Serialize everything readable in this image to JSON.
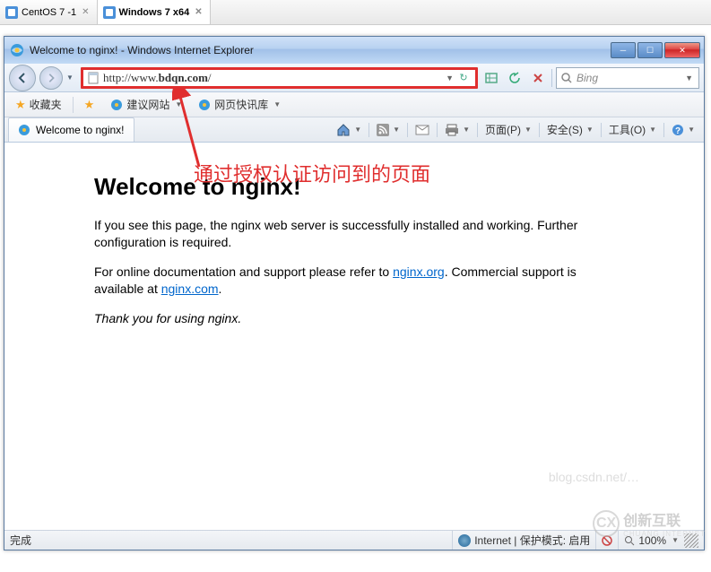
{
  "vm_tabs": {
    "tab1": "CentOS 7 -1",
    "tab2": "Windows 7 x64"
  },
  "window": {
    "title": "Welcome to nginx! - Windows Internet Explorer"
  },
  "nav": {
    "url_prefix": "http://www.",
    "url_bold": "bdqn.com",
    "url_suffix": "/",
    "search_placeholder": "Bing"
  },
  "favbar": {
    "favorites": "收藏夹",
    "suggested": "建议网站",
    "webfeed": "网页快讯库"
  },
  "tab": {
    "title": "Welcome to nginx!"
  },
  "commandbar": {
    "page": "页面(P)",
    "safety": "安全(S)",
    "tools": "工具(O)"
  },
  "annotation": {
    "text": "通过授权认证访问到的页面"
  },
  "page": {
    "heading": "Welcome to nginx!",
    "p1": "If you see this page, the nginx web server is successfully installed and working. Further configuration is required.",
    "p2a": "For online documentation and support please refer to ",
    "link1": "nginx.org",
    "p2b": ". Commercial support is available at ",
    "link2": "nginx.com",
    "p2c": ".",
    "p3": "Thank you for using nginx."
  },
  "statusbar": {
    "done": "完成",
    "zone": "Internet | 保护模式: 启用",
    "zoom": "100%"
  },
  "watermark": {
    "brand": "创新互联",
    "faded": "blog.csdn.net/…"
  }
}
